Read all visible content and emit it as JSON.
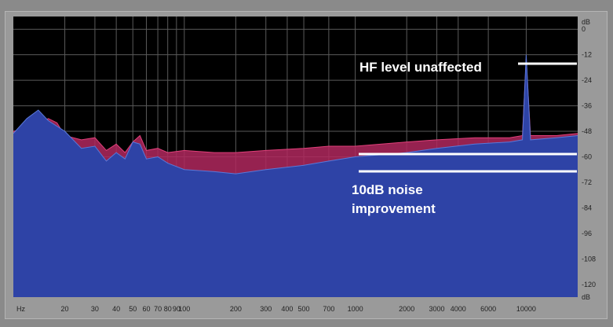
{
  "chart_data": {
    "type": "area",
    "title": "",
    "xlabel": "",
    "ylabel": "",
    "x_unit": "Hz",
    "y_unit": "dB",
    "x_scale": "log",
    "xlim": [
      10,
      20000
    ],
    "ylim": [
      -126,
      6
    ],
    "grid": true,
    "x_ticks": [
      {
        "v": 20,
        "label": "20"
      },
      {
        "v": 30,
        "label": "30"
      },
      {
        "v": 40,
        "label": "40"
      },
      {
        "v": 50,
        "label": "50"
      },
      {
        "v": 60,
        "label": "60"
      },
      {
        "v": 70,
        "label": "70"
      },
      {
        "v": 80,
        "label": "80"
      },
      {
        "v": 90,
        "label": "90"
      },
      {
        "v": 100,
        "label": "100"
      },
      {
        "v": 200,
        "label": "200"
      },
      {
        "v": 300,
        "label": "300"
      },
      {
        "v": 400,
        "label": "400"
      },
      {
        "v": 500,
        "label": "500"
      },
      {
        "v": 700,
        "label": "700"
      },
      {
        "v": 1000,
        "label": "1000"
      },
      {
        "v": 2000,
        "label": "2000"
      },
      {
        "v": 3000,
        "label": "3000"
      },
      {
        "v": 4000,
        "label": "4000"
      },
      {
        "v": 6000,
        "label": "6000"
      },
      {
        "v": 10000,
        "label": "10000"
      }
    ],
    "y_ticks": [
      0,
      -12,
      -24,
      -36,
      -48,
      -60,
      -72,
      -84,
      -96,
      -108,
      -120
    ],
    "series": [
      {
        "name": "",
        "color": "#b0285e",
        "points": [
          [
            10,
            -48
          ],
          [
            13,
            -46
          ],
          [
            16,
            -42
          ],
          [
            18,
            -44
          ],
          [
            20,
            -50
          ],
          [
            25,
            -52
          ],
          [
            30,
            -51
          ],
          [
            35,
            -57
          ],
          [
            40,
            -54
          ],
          [
            45,
            -58
          ],
          [
            50,
            -53
          ],
          [
            55,
            -50
          ],
          [
            60,
            -57
          ],
          [
            70,
            -56
          ],
          [
            80,
            -58
          ],
          [
            100,
            -57
          ],
          [
            150,
            -58
          ],
          [
            200,
            -58
          ],
          [
            300,
            -57
          ],
          [
            500,
            -56
          ],
          [
            700,
            -55
          ],
          [
            1000,
            -55
          ],
          [
            2000,
            -53
          ],
          [
            3000,
            -52
          ],
          [
            5000,
            -51
          ],
          [
            8000,
            -51
          ],
          [
            9500,
            -50
          ],
          [
            10000,
            -14
          ],
          [
            10600,
            -50
          ],
          [
            15000,
            -50
          ],
          [
            20000,
            -49
          ]
        ]
      },
      {
        "name": "",
        "color": "#5a78d8",
        "points": [
          [
            10,
            -49
          ],
          [
            12,
            -42
          ],
          [
            14,
            -38
          ],
          [
            16,
            -43
          ],
          [
            20,
            -48
          ],
          [
            25,
            -56
          ],
          [
            30,
            -55
          ],
          [
            35,
            -62
          ],
          [
            40,
            -58
          ],
          [
            45,
            -61
          ],
          [
            50,
            -53
          ],
          [
            55,
            -54
          ],
          [
            60,
            -61
          ],
          [
            70,
            -60
          ],
          [
            80,
            -63
          ],
          [
            100,
            -66
          ],
          [
            150,
            -67
          ],
          [
            200,
            -68
          ],
          [
            300,
            -66
          ],
          [
            500,
            -64
          ],
          [
            700,
            -62
          ],
          [
            1000,
            -60
          ],
          [
            2000,
            -58
          ],
          [
            3000,
            -56
          ],
          [
            5000,
            -54
          ],
          [
            8000,
            -53
          ],
          [
            9500,
            -52
          ],
          [
            10000,
            -12
          ],
          [
            10600,
            -52
          ],
          [
            15000,
            -51
          ],
          [
            20000,
            -50
          ]
        ]
      }
    ],
    "annotations": [
      {
        "text": "HF level unaffected",
        "x": 10000,
        "y": -12
      },
      {
        "text": "10dB noise improvement",
        "y_range": [
          -64,
          -54
        ]
      }
    ]
  },
  "axis": {
    "x_unit_label": "Hz",
    "y_unit_top": "dB",
    "y_unit_bottom": "dB"
  },
  "annotations_text": {
    "hf": "HF level unaffected",
    "noise_line1": "10dB noise",
    "noise_line2": "improvement"
  },
  "colors": {
    "plot_bg": "#000000",
    "grid": "#5a5a5a",
    "fill": "#2e43a6",
    "accent_red": "#b0285e",
    "annot": "#ffffff"
  }
}
